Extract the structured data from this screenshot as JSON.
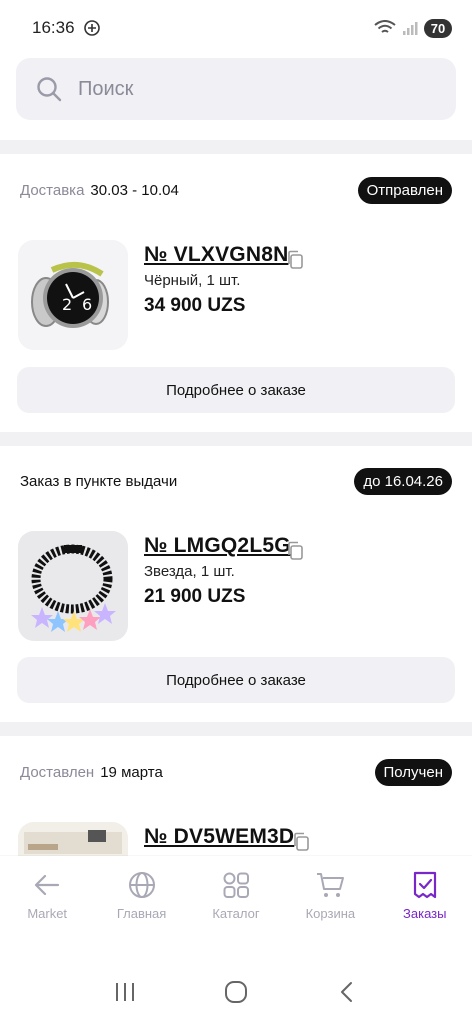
{
  "status": {
    "time": "16:36",
    "battery": "70"
  },
  "search": {
    "placeholder": "Поиск"
  },
  "orders": [
    {
      "label": "Доставка",
      "date": "30.03 - 10.04",
      "badge": "Отправлен",
      "number": "№ VLXVGN8N",
      "variant": "Чёрный, 1 шт.",
      "price": "34 900 UZS",
      "details": "Подробнее о заказе"
    },
    {
      "label": "Заказ в пункте выдачи",
      "date": "",
      "badge": "до 16.04.26",
      "number": "№ LMGQ2L5G",
      "variant": "Звезда, 1 шт.",
      "price": "21 900 UZS",
      "details": "Подробнее о заказе"
    },
    {
      "label": "Доставлен",
      "date": "19 марта",
      "badge": "Получен",
      "number": "№ DV5WEM3D",
      "variant": "",
      "price": "",
      "details": ""
    }
  ],
  "nav": {
    "items": [
      {
        "label": "Market",
        "icon": "arrow-left-icon"
      },
      {
        "label": "Главная",
        "icon": "globe-icon"
      },
      {
        "label": "Каталог",
        "icon": "catalog-grid-icon"
      },
      {
        "label": "Корзина",
        "icon": "cart-icon"
      },
      {
        "label": "Заказы",
        "icon": "orders-icon"
      }
    ],
    "active": "Заказы"
  },
  "colors": {
    "accent": "#7a27c9",
    "badge_bg": "#111111",
    "surface": "#f1f1f5"
  }
}
